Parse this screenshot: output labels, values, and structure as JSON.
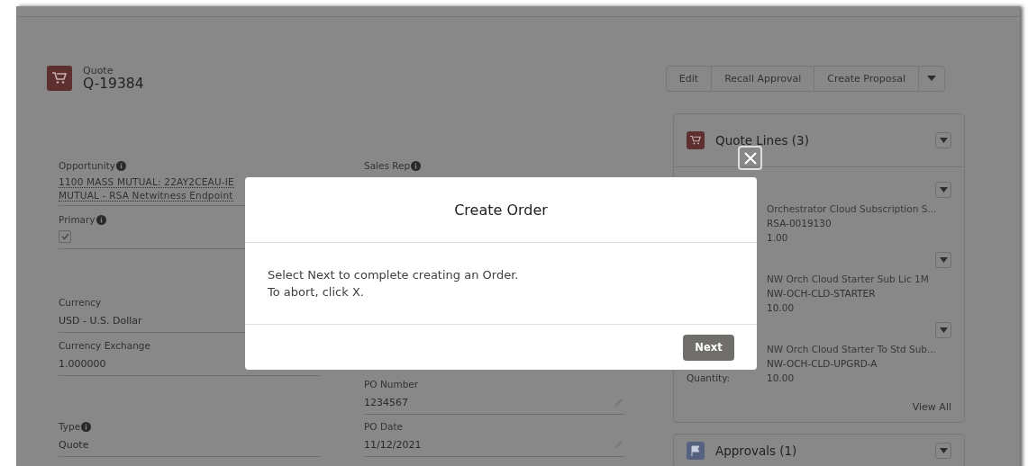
{
  "record": {
    "object_label": "Quote",
    "name": "Q-19384"
  },
  "actions": [
    {
      "label": "Edit"
    },
    {
      "label": "Recall Approval"
    },
    {
      "label": "Create Proposal"
    }
  ],
  "left_fields": [
    {
      "label": "Opportunity",
      "info": true,
      "kind": "link",
      "lines": [
        "1100 MASS MUTUAL: 22AY2CEAU-IE",
        "MUTUAL - RSA Netwitness Endpoint"
      ]
    },
    {
      "label": "Primary",
      "info": true,
      "kind": "checkbox",
      "checked": true
    },
    {
      "label": "Currency",
      "info": false,
      "kind": "text",
      "value": "USD - U.S. Dollar"
    },
    {
      "label": "Currency Exchange",
      "info": false,
      "kind": "text",
      "value": "1.000000"
    },
    {
      "label": "Type",
      "info": true,
      "kind": "text",
      "value": "Quote"
    }
  ],
  "right_fields": [
    {
      "label": "Sales Rep",
      "info": true,
      "kind": "text",
      "editable": false
    },
    {
      "label": "PO Number",
      "info": false,
      "kind": "text",
      "value": "1234567",
      "editable": true
    },
    {
      "label": "PO Date",
      "info": false,
      "kind": "text",
      "value": "11/12/2021",
      "editable": true
    }
  ],
  "quote_lines": {
    "title": "Quote Lines (3)",
    "items": [
      {
        "name": "Orchestrator Cloud Subscription S...",
        "code": "RSA-0019130",
        "quantity": "1.00"
      },
      {
        "name": "NW Orch Cloud Starter Sub Lic 1M",
        "code": "NW-OCH-CLD-STARTER",
        "quantity": "10.00"
      },
      {
        "name": "NW Orch Cloud Starter To Std Sub...",
        "code": "NW-OCH-CLD-UPGRD-A",
        "quantity_label": "Quantity:",
        "quantity": "10.00"
      }
    ],
    "view_all": "View All"
  },
  "approvals": {
    "title": "Approvals (1)"
  },
  "modal": {
    "title": "Create Order",
    "lines": [
      "Select Next to complete creating an Order.",
      "To abort, click X."
    ],
    "button": "Next"
  }
}
